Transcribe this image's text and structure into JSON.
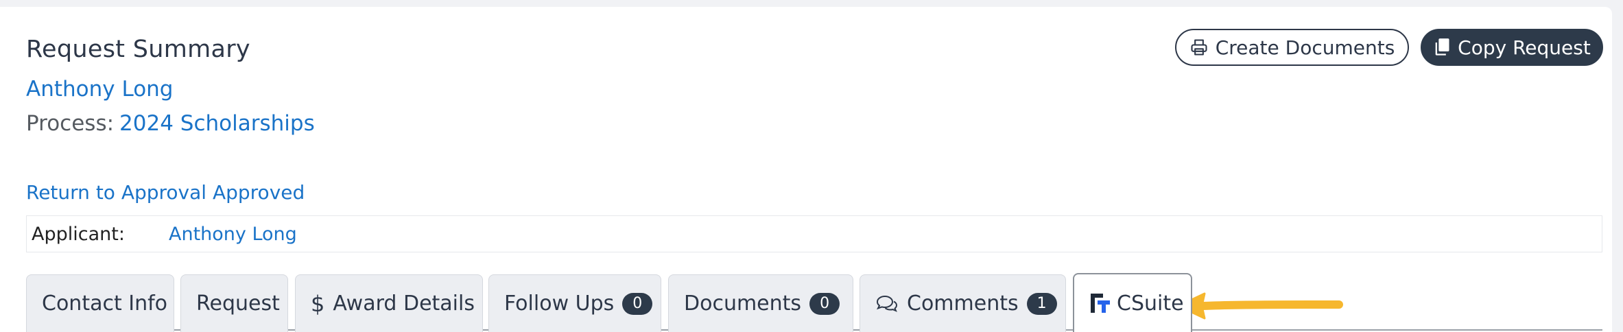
{
  "header": {
    "title": "Request Summary",
    "applicant_link": "Anthony Long",
    "process_label": "Process:",
    "process_link": "2024 Scholarships",
    "return_link": "Return to Approval Approved"
  },
  "actions": {
    "create_documents": "Create Documents",
    "copy_request": "Copy Request"
  },
  "applicant": {
    "label": "Applicant:",
    "value": "Anthony Long"
  },
  "tabs": [
    {
      "label": "Contact Info"
    },
    {
      "label": "Request"
    },
    {
      "label": "Award Details",
      "icon": "dollar-icon"
    },
    {
      "label": "Follow Ups",
      "badge": "0"
    },
    {
      "label": "Documents",
      "badge": "0"
    },
    {
      "label": "Comments",
      "badge": "1",
      "icon": "comments-icon"
    },
    {
      "label": "CSuite",
      "icon": "csuite-logo-icon",
      "active": true
    }
  ],
  "colors": {
    "link": "#1a73c8",
    "dark": "#2d3a4a",
    "arrow": "#f6b72e"
  }
}
